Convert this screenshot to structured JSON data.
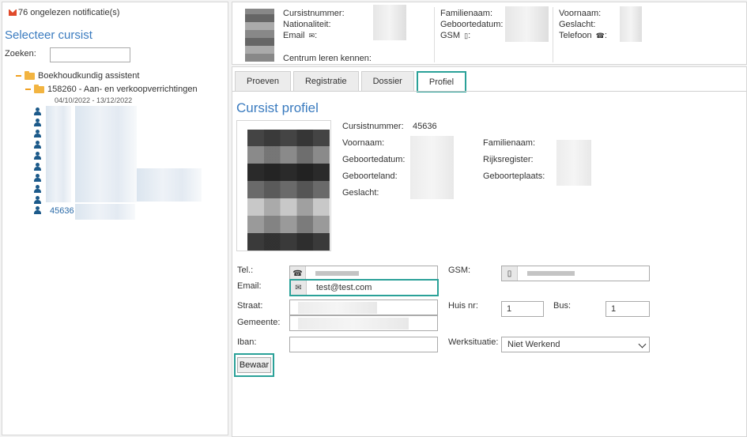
{
  "left": {
    "notification_text": "76 ongelezen notificatie(s)",
    "select_title": "Selecteer cursist",
    "search_label": "Zoeken:",
    "search_value": "",
    "tree": {
      "root_label": "Boekhoudkundig assistent",
      "course_label": "158260 - Aan- en verkoopverrichtingen",
      "course_dates": "04/10/2022 - 13/12/2022"
    },
    "student_link": "45636",
    "icon_user": "user-icon",
    "icon_folder": "folder-open-icon",
    "icon_mail": "envelope-icon"
  },
  "header": {
    "cursistnummer": "Cursistnummer:",
    "nationaliteit": "Nationaliteit:",
    "email": "Email",
    "centrum": "Centrum leren kennen:",
    "familienaam": "Familienaam:",
    "geboortedatum": "Geboortedatum:",
    "gsm": "GSM",
    "voornaam": "Voornaam:",
    "geslacht": "Geslacht:",
    "telefoon": "Telefoon",
    "colon": ":"
  },
  "tabs": [
    {
      "label": "Proeven"
    },
    {
      "label": "Registratie"
    },
    {
      "label": "Dossier"
    },
    {
      "label": "Profiel"
    }
  ],
  "profile": {
    "title": "Cursist profiel",
    "cursistnummer_label": "Cursistnummer:",
    "cursistnummer_value": "45636",
    "voornaam_label": "Voornaam:",
    "familienaam_label": "Familienaam:",
    "geboortedatum_label": "Geboortedatum:",
    "rijksregister_label": "Rijksregister:",
    "geboorteland_label": "Geboorteland:",
    "geboorteplaats_label": "Geboorteplaats:",
    "geslacht_label": "Geslacht:"
  },
  "form": {
    "tel_label": "Tel.:",
    "gsm_label": "GSM:",
    "email_label": "Email:",
    "email_value": "test@test.com",
    "straat_label": "Straat:",
    "gemeente_label": "Gemeente:",
    "huisnr_label": "Huis nr:",
    "huisnr_value": "1",
    "bus_label": "Bus:",
    "bus_value": "1",
    "iban_label": "Iban:",
    "iban_value": "",
    "werksituatie_label": "Werksituatie:",
    "werksituatie_value": "Niet Werkend",
    "save_label": "Bewaar"
  },
  "colors": {
    "accent": "#3a7bbf",
    "highlight": "#2aa198",
    "link": "#2a6aa8",
    "folder": "#f2b441",
    "notification": "#e04a2b"
  }
}
